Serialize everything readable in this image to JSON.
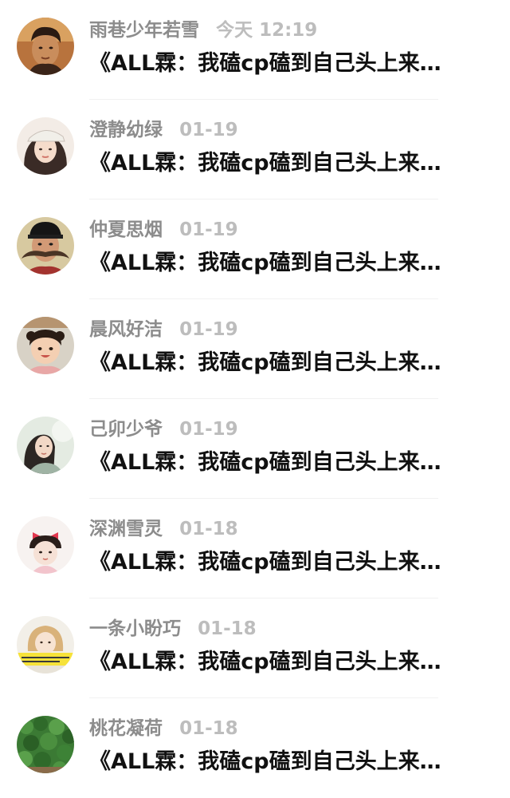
{
  "comments": [
    {
      "name": "雨巷少年若雪",
      "time": "今天 12:19",
      "message": "《ALL霖：我磕cp磕到自己头上来…",
      "avatar_icon": "man-portrait-avatar"
    },
    {
      "name": "澄静幼绿",
      "time": "01-19",
      "message": "《ALL霖：我磕cp磕到自己头上来…",
      "avatar_icon": "girl-cap-avatar"
    },
    {
      "name": "仲夏思烟",
      "time": "01-19",
      "message": "《ALL霖：我磕cp磕到自己头上来…",
      "avatar_icon": "mustache-man-avatar"
    },
    {
      "name": "晨风好洁",
      "time": "01-19",
      "message": "《ALL霖：我磕cp磕到自己头上来…",
      "avatar_icon": "child-avatar"
    },
    {
      "name": "己卯少爷",
      "time": "01-19",
      "message": "《ALL霖：我磕cp磕到自己头上来…",
      "avatar_icon": "woman-outdoor-avatar"
    },
    {
      "name": "深渊雪灵",
      "time": "01-18",
      "message": "《ALL霖：我磕cp磕到自己头上来…",
      "avatar_icon": "girl-bow-avatar"
    },
    {
      "name": "一条小盼巧",
      "time": "01-18",
      "message": "《ALL霖：我磕cp磕到自己头上来…",
      "avatar_icon": "cartoon-girl-avatar"
    },
    {
      "name": "桃花凝荷",
      "time": "01-18",
      "message": "《ALL霖：我磕cp磕到自己头上来…",
      "avatar_icon": "green-ivy-avatar"
    }
  ]
}
